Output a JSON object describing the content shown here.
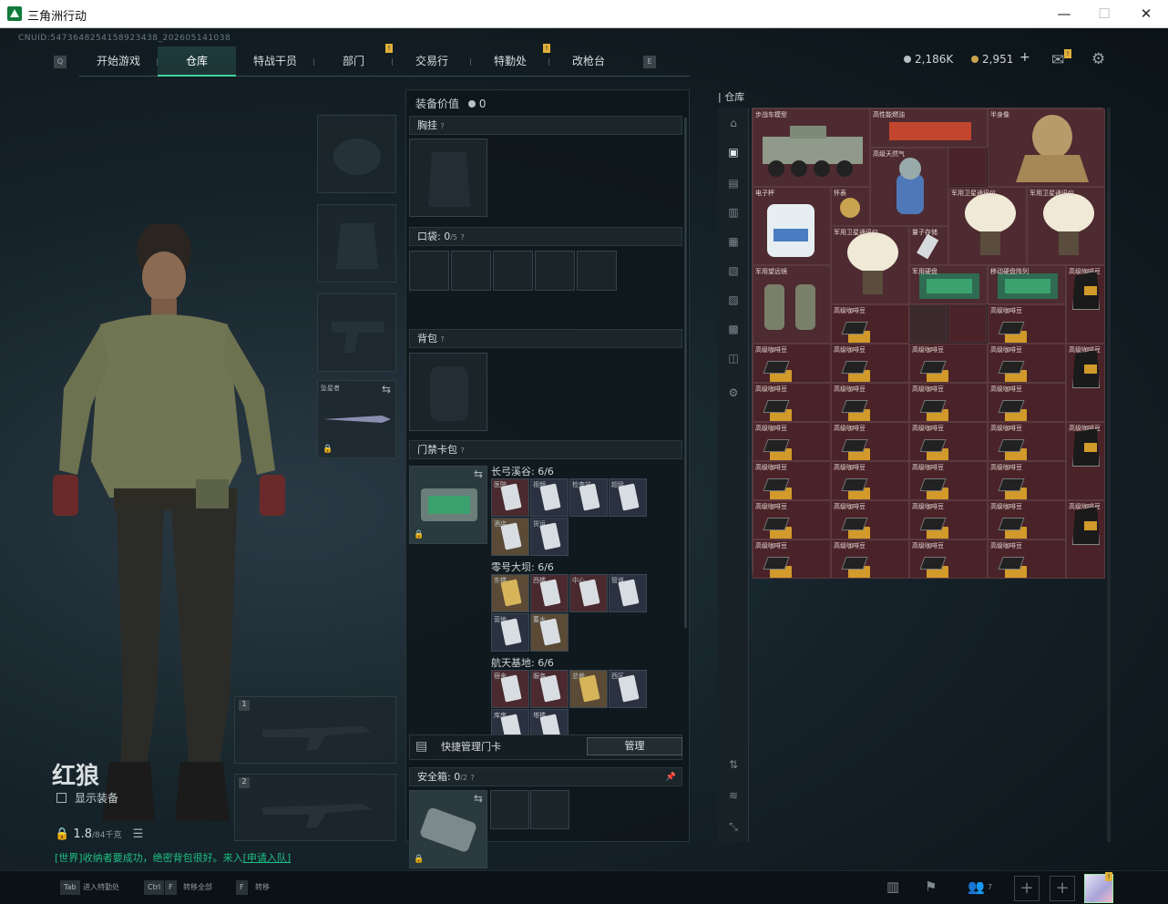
{
  "window": {
    "title": "三角洲行动",
    "minimize": "—",
    "maximize": "☐",
    "close": "✕"
  },
  "cnuid": "CNUID:5473648254158923438_202605141038",
  "nav": {
    "tabs": [
      "开始游戏",
      "仓库",
      "特战干员",
      "部门",
      "交易行",
      "特勤处",
      "改枪台"
    ],
    "active": "仓库",
    "left_key": "Q",
    "right_key": "E"
  },
  "currency": {
    "silver": "2,186K",
    "gold": "2,951",
    "add": "+"
  },
  "header_icons": [
    "mail-icon",
    "gear-icon"
  ],
  "character": {
    "name": "红狼",
    "show_equip_label": "显示装备",
    "weight_value": "1.8",
    "weight_max": "/84千克",
    "hint_prefix": "[世界]",
    "hint_text": "收纳者要成功，绝密背包很好。来入",
    "hint_link": "[申请入队]",
    "slot_labels": [
      "头盔",
      "护甲",
      "手枪",
      "近战武器"
    ],
    "melee_name": "坠星者",
    "weapon_slot_numbers": [
      "1",
      "2"
    ]
  },
  "equipment": {
    "value_label": "装备价值",
    "value": "0",
    "chest_rig_label": "胸挂",
    "pocket_label": "口袋:",
    "pocket_count": "0",
    "pocket_max": "/5",
    "backpack_label": "背包",
    "keycard_label": "门禁卡包",
    "keycard_groups": [
      {
        "map": "长弓溪谷: 6/6",
        "cards": [
          {
            "name": "医院",
            "tone": "red"
          },
          {
            "name": "视频",
            "tone": "blue"
          },
          {
            "name": "检查站",
            "tone": "blue"
          },
          {
            "name": "超级",
            "tone": "blue"
          },
          {
            "name": "酒店",
            "tone": "tan"
          },
          {
            "name": "货运",
            "tone": "blue"
          }
        ]
      },
      {
        "map": "零号大坝: 6/6",
        "cards": [
          {
            "name": "东楼",
            "tone": "tan",
            "gold": true
          },
          {
            "name": "西楼",
            "tone": "red"
          },
          {
            "name": "中心",
            "tone": "red"
          },
          {
            "name": "管道",
            "tone": "blue"
          },
          {
            "name": "营地",
            "tone": "blue"
          },
          {
            "name": "蓄水",
            "tone": "tan"
          }
        ]
      },
      {
        "map": "航天基地: 6/6",
        "cards": [
          {
            "name": "宿舍",
            "tone": "red"
          },
          {
            "name": "服务",
            "tone": "red"
          },
          {
            "name": "总裁",
            "tone": "tan",
            "gold": true
          },
          {
            "name": "西区",
            "tone": "blue"
          },
          {
            "name": "库房",
            "tone": "blue"
          },
          {
            "name": "塔楼",
            "tone": "blue"
          }
        ]
      }
    ],
    "quick_manage_label": "快捷管理门卡",
    "manage_button": "管理",
    "safe_box_label": "安全箱:",
    "safe_box_count": "0",
    "safe_box_max": "/2"
  },
  "storage": {
    "title": "仓库",
    "items": [
      {
        "name": "步战车模型"
      },
      {
        "name": "高性能燃油"
      },
      {
        "name": "半身像"
      },
      {
        "name": "高级天然气"
      },
      {
        "name": "电子秤"
      },
      {
        "name": "电动气罐"
      },
      {
        "name": "怀表"
      },
      {
        "name": "军用卫星通讯仪"
      },
      {
        "name": "军用卫星通讯仪"
      },
      {
        "name": "军用卫星通讯仪"
      },
      {
        "name": "量子存储"
      },
      {
        "name": "军用望远镜"
      },
      {
        "name": "军用硬盘"
      },
      {
        "name": "移动硬盘阵列"
      },
      {
        "name": "高级咖啡豆"
      },
      {
        "name": "高级咖啡豆"
      },
      {
        "name": "高级咖啡豆"
      },
      {
        "name": "高级咖啡豆"
      },
      {
        "name": "高级咖啡豆"
      },
      {
        "name": "高级咖啡豆"
      }
    ],
    "box_label": "高级咖啡豆"
  },
  "bottom": {
    "keys": [
      {
        "key": "Tab",
        "label": "进入特勤处"
      },
      {
        "key": "Ctrl",
        "key2": "F",
        "label": "转移全部"
      },
      {
        "key": "F",
        "label": "转移"
      }
    ],
    "friends_count": "7",
    "plus": "+"
  },
  "colors": {
    "accent": "#3ed59b",
    "notice": "#e0b03a",
    "hint": "#1fbf83"
  }
}
